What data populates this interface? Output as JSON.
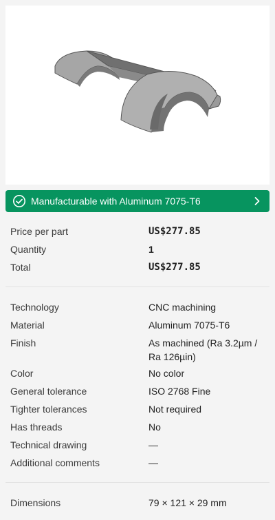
{
  "banner": {
    "label": "Manufacturable with Aluminum 7075-T6"
  },
  "pricing": {
    "price_label": "Price per part",
    "price_value": "US$277.85",
    "quantity_label": "Quantity",
    "quantity_value": "1",
    "total_label": "Total",
    "total_value": "US$277.85"
  },
  "specs": {
    "technology_label": "Technology",
    "technology_value": "CNC machining",
    "material_label": "Material",
    "material_value": "Aluminum 7075-T6",
    "finish_label": "Finish",
    "finish_value_line1": "As machined (Ra 3.2µm /",
    "finish_value_line2": "Ra 126µin)",
    "color_label": "Color",
    "color_value": "No color",
    "general_tol_label": "General tolerance",
    "general_tol_value": "ISO 2768 Fine",
    "tighter_tol_label": "Tighter tolerances",
    "tighter_tol_value": "Not required",
    "threads_label": "Has threads",
    "threads_value": "No",
    "drawing_label": "Technical drawing",
    "drawing_value": "—",
    "comments_label": "Additional comments",
    "comments_value": "—"
  },
  "dimensions": {
    "label": "Dimensions",
    "value": "79 × 121 × 29 mm"
  },
  "colors": {
    "banner": "#07945f",
    "background": "#f4f4f4",
    "preview": "#ffffff"
  }
}
